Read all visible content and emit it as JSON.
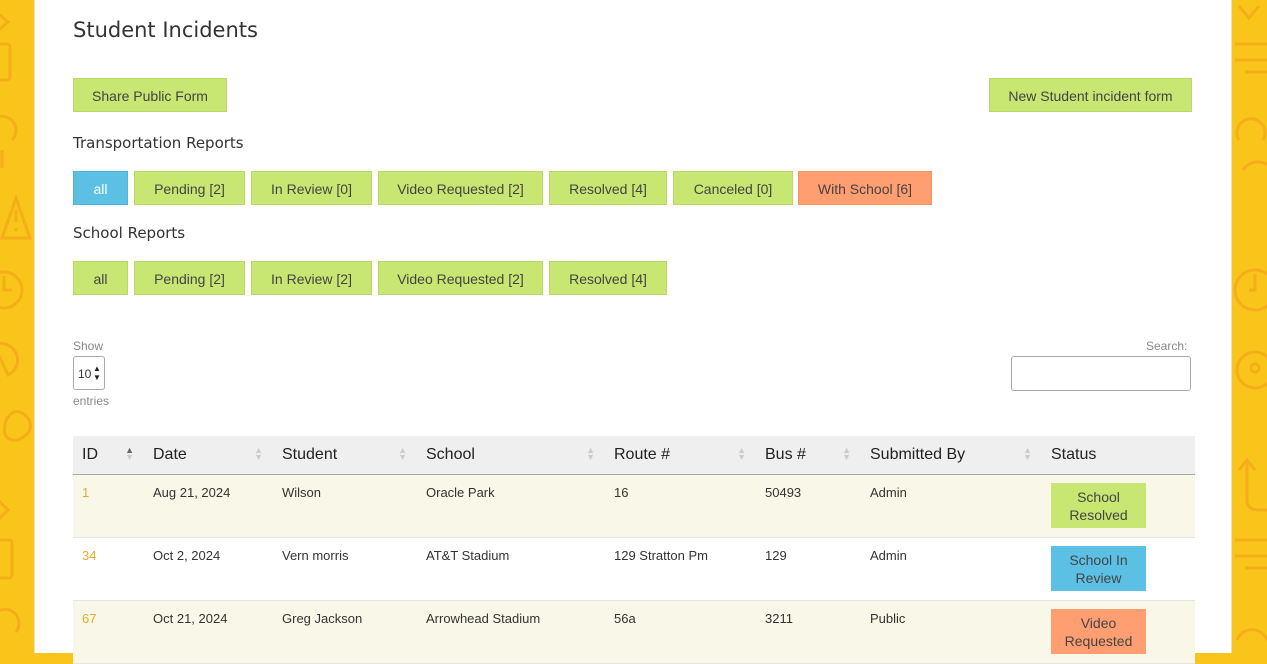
{
  "page": {
    "title": "Student Incidents",
    "share_button": "Share Public Form",
    "new_form_button": "New Student incident form"
  },
  "transportation": {
    "title": "Transportation Reports",
    "filters": [
      "all",
      "Pending [2]",
      "In Review [0]",
      "Video Requested [2]",
      "Resolved [4]",
      "Canceled [0]",
      "With School [6]"
    ]
  },
  "school": {
    "title": "School Reports",
    "filters": [
      "all",
      "Pending [2]",
      "In Review [2]",
      "Video Requested [2]",
      "Resolved [4]"
    ]
  },
  "table_controls": {
    "show_label": "Show",
    "page_length": "10",
    "entries_label": "entries",
    "search_label": "Search:",
    "search_value": ""
  },
  "table": {
    "columns": [
      "ID",
      "Date",
      "Student",
      "School",
      "Route #",
      "Bus #",
      "Submitted By",
      "Status"
    ],
    "rows": [
      {
        "id": "1",
        "date": "Aug 21, 2024",
        "student": "Wilson",
        "school": "Oracle Park",
        "route": "16",
        "bus": "50493",
        "submitted_by": "Admin",
        "status": "School Resolved",
        "status_color": "#c8e672"
      },
      {
        "id": "34",
        "date": "Oct 2, 2024",
        "student": "Vern morris",
        "school": "AT&T Stadium",
        "route": "129 Stratton Pm",
        "bus": "129",
        "submitted_by": "Admin",
        "status": "School In Review",
        "status_color": "#5bc0e4"
      },
      {
        "id": "67",
        "date": "Oct 21, 2024",
        "student": "Greg Jackson",
        "school": "Arrowhead Stadium",
        "route": "56a",
        "bus": "3211",
        "submitted_by": "Public",
        "status": "Video Requested",
        "status_color": "#ff9f71"
      }
    ]
  },
  "colors": {
    "accent_green": "#c8e672",
    "accent_blue": "#5bc0e4",
    "accent_orange": "#ff9f71",
    "background_yellow": "#f9c51a",
    "link_orange": "#e8a92a"
  }
}
